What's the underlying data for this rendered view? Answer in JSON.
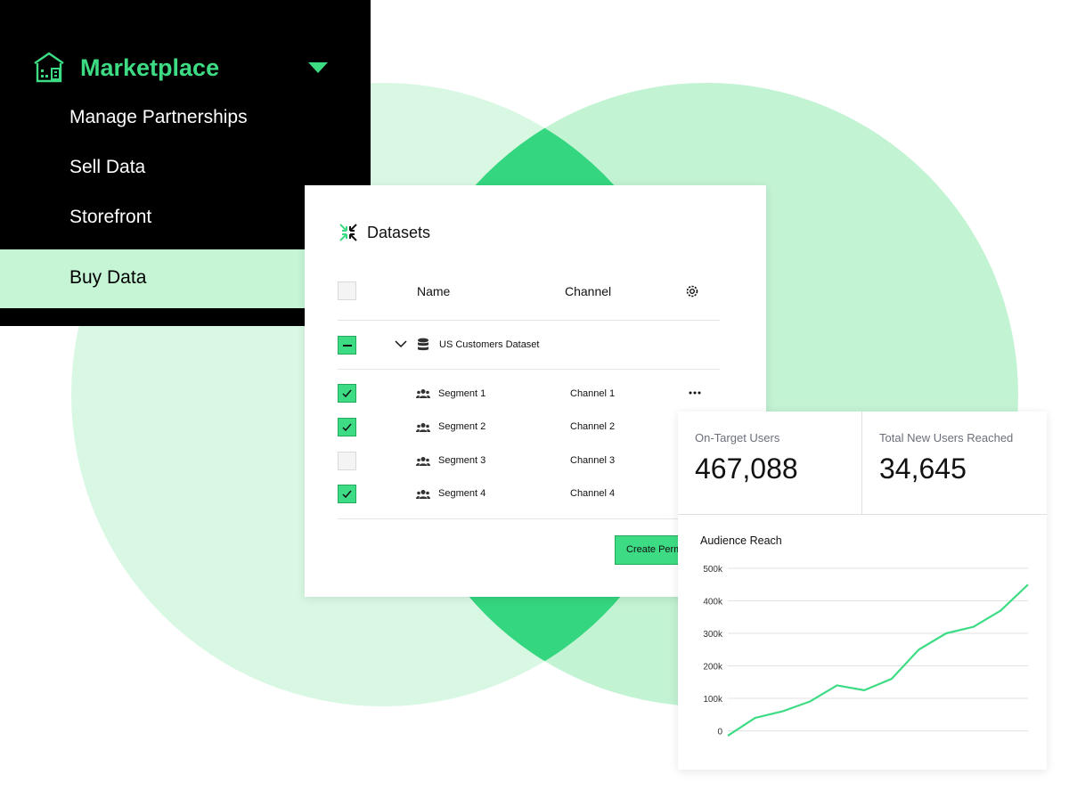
{
  "sidebar": {
    "section_label": "Marketplace",
    "items": [
      {
        "label": "Manage Partnerships"
      },
      {
        "label": "Sell Data"
      },
      {
        "label": "Storefront"
      },
      {
        "label": "Buy Data"
      }
    ]
  },
  "datasets": {
    "title": "Datasets",
    "columns": {
      "name": "Name",
      "channel": "Channel"
    },
    "dataset_name": "US Customers Dataset",
    "rows": [
      {
        "name": "Segment 1",
        "channel": "Channel 1",
        "checked": true
      },
      {
        "name": "Segment 2",
        "channel": "Channel 2",
        "checked": true
      },
      {
        "name": "Segment 3",
        "channel": "Channel 3",
        "checked": false
      },
      {
        "name": "Segment 4",
        "channel": "Channel 4",
        "checked": true
      }
    ],
    "create_button": "Create Perm"
  },
  "metrics": [
    {
      "label": "On-Target Users",
      "value": "467,088"
    },
    {
      "label": "Total New Users Reached",
      "value": "34,645"
    }
  ],
  "colors": {
    "accent": "#3ddc84",
    "active_bg": "#c6f5d6",
    "circle_light": "#d9f8e4",
    "circle_mid": "#c2f3d3"
  },
  "chart_data": {
    "type": "line",
    "title": "Audience Reach",
    "y_ticks": [
      "500k",
      "400k",
      "300k",
      "200k",
      "100k",
      "0"
    ],
    "ylim": [
      -50000,
      500000
    ],
    "series": [
      {
        "values": [
          -15000,
          40000,
          60000,
          90000,
          140000,
          125000,
          160000,
          250000,
          300000,
          320000,
          370000,
          450000
        ]
      }
    ]
  }
}
